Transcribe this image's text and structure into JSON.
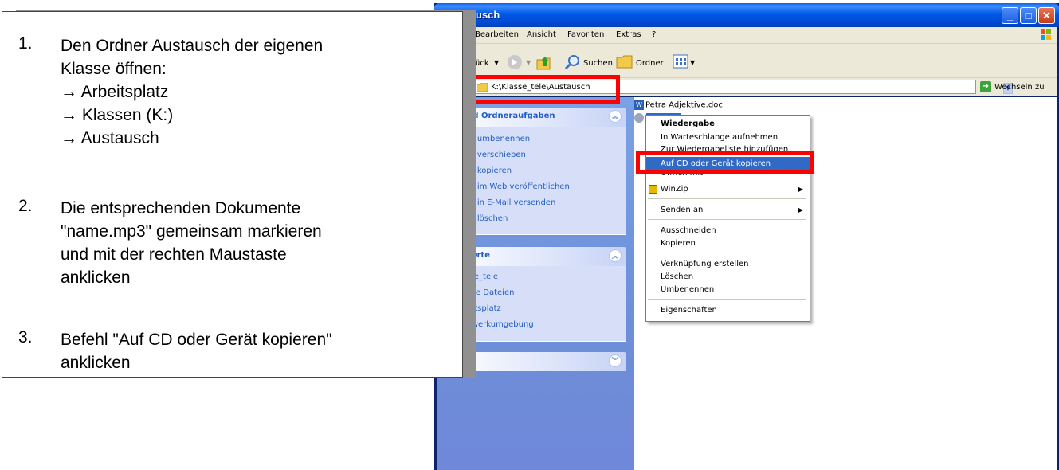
{
  "window": {
    "title": "usch",
    "menu": [
      "Bearbeiten",
      "Ansicht",
      "Favoriten",
      "Extras",
      "?"
    ],
    "toolbar": {
      "back": "ück",
      "search": "Suchen",
      "folders": "Ordner"
    },
    "address": {
      "path": "K:\\Klasse_tele\\Austausch",
      "go": "Wechseln zu"
    }
  },
  "left_pane": {
    "tasks": {
      "header": "i- und Ordneraufgaben",
      "items": [
        "Datei umbenennen",
        "Datei verschieben",
        "Datei kopieren",
        "Datei im Web veröffentlichen",
        "Datei in E-Mail versenden",
        "Datei löschen"
      ]
    },
    "places": {
      "header": "ere Orte",
      "items": [
        "Klasse_tele",
        "Eigene Dateien",
        "Arbeitsplatz",
        "Netzwerkumgebung"
      ]
    },
    "details": {
      "header": "ils"
    }
  },
  "files": [
    {
      "name": "Petra Adjektive.doc",
      "icon": "word-doc-icon"
    },
    {
      "name": "",
      "icon": "audio-file-icon"
    }
  ],
  "context_menu": {
    "items": [
      {
        "label": "Wiedergabe",
        "bold": true
      },
      {
        "label": "In Warteschlange aufnehmen"
      },
      {
        "label": "Zur Wiedergabeliste hinzufügen"
      },
      {
        "label": "Auf CD oder Gerät kopieren",
        "highlighted": true
      },
      {
        "label": "Öffnen mit"
      },
      {
        "label": "WinZip"
      },
      {
        "label": "Senden an"
      },
      {
        "label": "Ausschneiden"
      },
      {
        "label": "Kopieren"
      },
      {
        "label": "Verknüpfung erstellen"
      },
      {
        "label": "Löschen"
      },
      {
        "label": "Umbenennen"
      },
      {
        "label": "Eigenschaften"
      }
    ]
  },
  "instructions": {
    "step1": {
      "num": "1.",
      "line1": "Den Ordner Austausch der eigenen",
      "line2": "Klasse öffnen:",
      "line3": "→ Arbeitsplatz",
      "line4": "→ Klassen (K:)",
      "line5": "→ Austausch"
    },
    "step2": {
      "num": "2.",
      "line1": "Die entsprechenden Dokumente",
      "line2": "\"name.mp3\" gemeinsam markieren",
      "line3": "und mit der rechten Maustaste",
      "line4": "anklicken"
    },
    "step3": {
      "num": "3.",
      "line1": "Befehl \"Auf CD oder Gerät kopieren\"",
      "line2": "anklicken"
    }
  },
  "colors": {
    "highlight_box": "#ff0000",
    "title_blue": "#0058e6",
    "selection": "#316ac5"
  }
}
